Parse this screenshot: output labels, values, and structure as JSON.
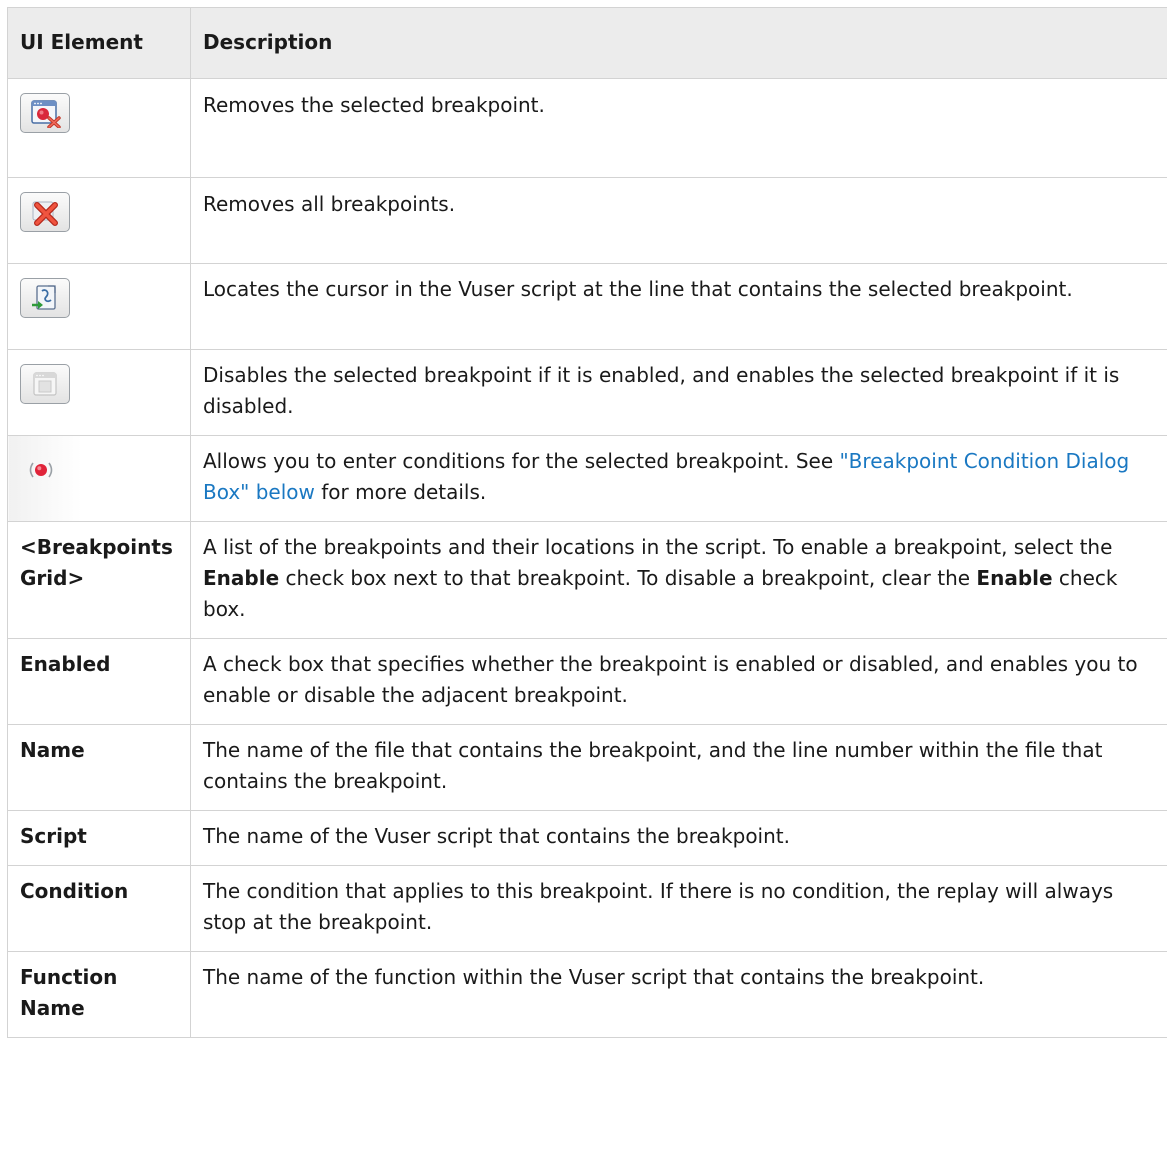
{
  "header": {
    "col_element": "UI Element",
    "col_description": "Description"
  },
  "rows": [
    {
      "icon": "remove-breakpoint-icon",
      "description": "Removes the selected breakpoint."
    },
    {
      "icon": "remove-all-breakpoints-icon",
      "description": "Removes all breakpoints."
    },
    {
      "icon": "locate-breakpoint-icon",
      "description": "Locates the cursor in the Vuser script at the line that contains the selected breakpoint."
    },
    {
      "icon": "toggle-breakpoint-icon",
      "description": "Disables the selected breakpoint if it is enabled, and enables the selected breakpoint if it is disabled."
    },
    {
      "icon": "breakpoint-condition-icon",
      "description_pre": "Allows you to enter conditions for the selected breakpoint. See ",
      "link_text": "\"Breakpoint Condition Dialog Box\" below",
      "description_post": " for more details."
    },
    {
      "element": "<Breakpoints Grid>",
      "desc_1": "A list of the breakpoints and their locations in the script. To enable a breakpoint, select the ",
      "desc_bold_1": "Enable",
      "desc_2": " check box next to that breakpoint. To disable a breakpoint, clear the ",
      "desc_bold_2": "Enable",
      "desc_3": " check box."
    },
    {
      "element": "Enabled",
      "description": "A check box that specifies whether the breakpoint is enabled or disabled, and enables you to enable or disable the adjacent breakpoint."
    },
    {
      "element": "Name",
      "description": "The name of the file that contains the breakpoint, and the line number within the file that contains the breakpoint."
    },
    {
      "element": "Script",
      "description": "The name of the Vuser script that contains the breakpoint."
    },
    {
      "element": "Condition",
      "description": "The condition that applies to this breakpoint. If there is no condition, the replay will always stop at the breakpoint."
    },
    {
      "element": "Function Name",
      "description": "The name of the function within the Vuser script that contains the breakpoint."
    }
  ],
  "colors": {
    "link": "#1a78c2",
    "header_bg": "#ececec",
    "border": "#d3d3d3"
  }
}
